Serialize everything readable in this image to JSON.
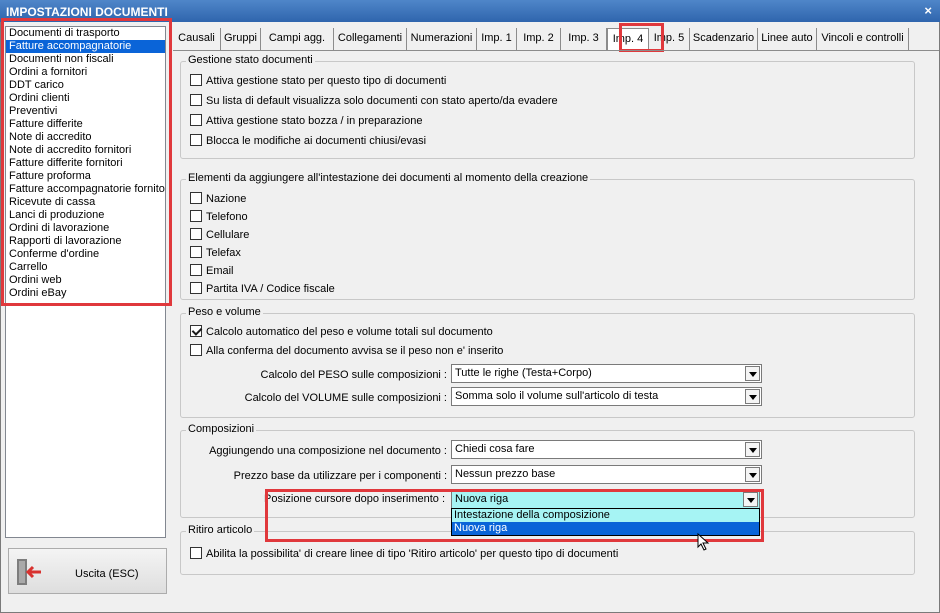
{
  "window": {
    "title": "IMPOSTAZIONI DOCUMENTI",
    "close_glyph": "×"
  },
  "doc_types": {
    "items": [
      "Documenti di trasporto",
      "Fatture accompagnatorie",
      "Documenti non fiscali",
      "Ordini a fornitori",
      "DDT carico",
      "Ordini clienti",
      "Preventivi",
      "Fatture differite",
      "Note di accredito",
      "Note di accredito fornitori",
      "Fatture differite fornitori",
      "Fatture proforma",
      "Fatture accompagnatorie fornito",
      "Ricevute di cassa",
      "Lanci di produzione",
      "Ordini di lavorazione",
      "Rapporti di lavorazione",
      "Conferme d'ordine",
      "Carrello",
      "Ordini web",
      "Ordini eBay"
    ],
    "selected": "Fatture accompagnatorie"
  },
  "exit_button": {
    "label": "Uscita (ESC)",
    "icon": "exit-door-icon"
  },
  "tabs": {
    "items": [
      "Causali",
      "Gruppi",
      "Campi agg.",
      "Collegamenti",
      "Numerazioni",
      "Imp. 1",
      "Imp. 2",
      "Imp. 3",
      "Imp. 4",
      "Imp. 5",
      "Scadenzario",
      "Linee auto",
      "Vincoli e controlli"
    ],
    "active": "Imp. 4"
  },
  "stato": {
    "title": "Gestione stato documenti",
    "options": [
      {
        "label": "Attiva gestione stato per questo tipo di documenti",
        "checked": false
      },
      {
        "label": "Su lista di default visualizza solo documenti con stato aperto/da evadere",
        "checked": false
      },
      {
        "label": "Attiva gestione stato bozza / in preparazione",
        "checked": false
      },
      {
        "label": "Blocca le modifiche ai documenti chiusi/evasi",
        "checked": false
      }
    ]
  },
  "intestazione": {
    "title": "Elementi da aggiungere all'intestazione dei documenti al momento della creazione",
    "options": [
      {
        "label": "Nazione",
        "checked": false
      },
      {
        "label": "Telefono",
        "checked": false
      },
      {
        "label": "Cellulare",
        "checked": false
      },
      {
        "label": "Telefax",
        "checked": false
      },
      {
        "label": "Email",
        "checked": false
      },
      {
        "label": "Partita IVA / Codice fiscale",
        "checked": false
      }
    ]
  },
  "peso": {
    "title": "Peso e volume",
    "options": [
      {
        "label": "Calcolo automatico del peso e volume totali sul documento",
        "checked": true
      },
      {
        "label": "Alla conferma del documento avvisa se il peso non e' inserito",
        "checked": false
      }
    ],
    "peso_label": "Calcolo del PESO sulle composizioni :",
    "peso_value": "Tutte le righe (Testa+Corpo)",
    "volume_label": "Calcolo del VOLUME sulle composizioni :",
    "volume_value": "Somma solo il volume sull'articolo di testa"
  },
  "composizioni": {
    "title": "Composizioni",
    "aggiungendo_label": "Aggiungendo una composizione nel documento :",
    "aggiungendo_value": "Chiedi cosa fare",
    "prezzo_label": "Prezzo base da utilizzare per i componenti :",
    "prezzo_value": "Nessun prezzo base",
    "cursore_label": "Posizione cursore dopo inserimento :",
    "cursore_value": "Nuova riga",
    "cursore_options": [
      "Intestazione della composizione",
      "Nuova riga"
    ]
  },
  "ritiro": {
    "title": "Ritiro articolo",
    "option": {
      "label": "Abilita la possibilita' di creare linee di tipo 'Ritiro articolo' per questo tipo di documenti",
      "checked": false
    }
  },
  "colors": {
    "highlight": "#e0383c",
    "selection": "#0a64d8",
    "dropdown_hover": "#a6f4f4"
  }
}
